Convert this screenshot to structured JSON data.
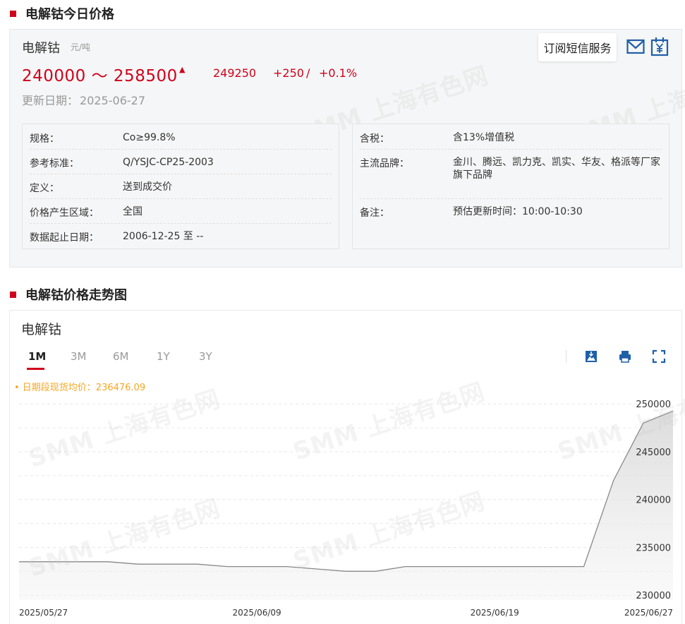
{
  "section1": {
    "title": "电解钴今日价格"
  },
  "price": {
    "product": "电解钴",
    "unit": "元/吨",
    "range": "240000 ～ 258500",
    "average": "249250",
    "change": "+250",
    "change_sep": "/",
    "change_pct": "+0.1%",
    "update_label": "更新日期：",
    "update_date": "2025-06-27"
  },
  "actions": {
    "sms_label": "订阅短信服务"
  },
  "info_left": [
    {
      "key": "规格：",
      "value": "Co≥99.8%"
    },
    {
      "key": "参考标准：",
      "value": "Q/YSJC-CP25-2003"
    },
    {
      "key": "定义：",
      "value": "送到成交价"
    },
    {
      "key": "价格产生区域：",
      "value": "全国"
    },
    {
      "key": "数据起止日期：",
      "value": "2006-12-25 至 --"
    }
  ],
  "info_right": [
    {
      "key": "含税：",
      "value": "含13%增值税"
    },
    {
      "key": "主流品牌：",
      "value": "金川、腾远、凯力克、凯实、华友、格派等厂家旗下品牌"
    },
    {
      "key": "备注：",
      "value": "预估更新时间：10:00-10:30"
    }
  ],
  "section2": {
    "title": "电解钴价格走势图"
  },
  "chart_panel": {
    "name": "电解钴",
    "tabs": [
      "1M",
      "3M",
      "6M",
      "1Y",
      "3Y"
    ],
    "active_tab": "1M",
    "avg_note": "• 日期段现货均价：236476.09"
  },
  "watermark": "SMM 上海有色网",
  "colors": {
    "accent": "#d0021b",
    "icon_blue": "#1f5fa8",
    "note_orange": "#f5a623",
    "line": "#888888"
  },
  "chart_data": {
    "type": "area",
    "x": [
      "2025/05/27",
      "2025/05/28",
      "2025/05/29",
      "2025/05/30",
      "2025/06/03",
      "2025/06/04",
      "2025/06/05",
      "2025/06/06",
      "2025/06/09",
      "2025/06/10",
      "2025/06/11",
      "2025/06/12",
      "2025/06/13",
      "2025/06/16",
      "2025/06/17",
      "2025/06/18",
      "2025/06/19",
      "2025/06/20",
      "2025/06/23",
      "2025/06/24",
      "2025/06/25",
      "2025/06/26",
      "2025/06/27"
    ],
    "series": [
      {
        "values": [
          233500,
          233500,
          233500,
          233500,
          233250,
          233250,
          233250,
          233000,
          233000,
          233000,
          232750,
          232500,
          232500,
          233000,
          233000,
          233000,
          233000,
          233000,
          233000,
          233000,
          242000,
          248000,
          249250
        ]
      }
    ],
    "xticks": [
      "2025/05/27",
      "2025/06/09",
      "2025/06/19",
      "2025/06/27"
    ],
    "yticks": [
      230000,
      235000,
      240000,
      245000,
      250000
    ],
    "ylim": [
      229500,
      250900
    ],
    "grid": true
  }
}
